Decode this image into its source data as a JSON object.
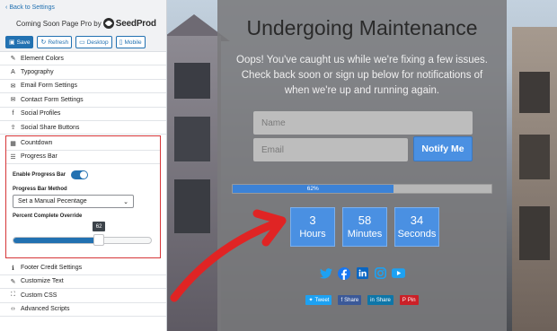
{
  "sidebar": {
    "back_link": "Back to Settings",
    "brand_text": "Coming Soon Page Pro by",
    "brand_name": "SeedProd",
    "toolbar": {
      "save": "Save",
      "refresh": "Refresh",
      "desktop": "Desktop",
      "mobile": "Mobile"
    },
    "menu_top": [
      {
        "label": "Element Colors",
        "icon": "paint-brush-icon"
      },
      {
        "label": "Typography",
        "icon": "text-icon"
      },
      {
        "label": "Email Form Settings",
        "icon": "envelope-icon"
      },
      {
        "label": "Contact Form Settings",
        "icon": "envelope-icon"
      },
      {
        "label": "Social Profiles",
        "icon": "facebook-square-icon"
      },
      {
        "label": "Social Share Buttons",
        "icon": "share-icon"
      },
      {
        "label": "Countdown",
        "icon": "calendar-icon"
      }
    ],
    "progress_panel": {
      "title": "Progress Bar",
      "enable_label": "Enable Progress Bar",
      "enabled": true,
      "method_label": "Progress Bar Method",
      "method_value": "Set a Manual Pecentage",
      "override_label": "Percent Complete Override",
      "override_value": "62",
      "override_fraction": 0.62
    },
    "menu_bottom": [
      {
        "label": "Footer Credit Settings",
        "icon": "info-icon"
      },
      {
        "label": "Customize Text",
        "icon": "pencil-icon"
      },
      {
        "label": "Custom CSS",
        "icon": "css-icon"
      },
      {
        "label": "Advanced Scripts",
        "icon": "code-icon"
      }
    ]
  },
  "preview": {
    "title": "Undergoing Maintenance",
    "description": "Oops! You've caught us while we're fixing a few issues. Check back soon or sign up below for notifications of when we're up and running again.",
    "name_placeholder": "Name",
    "email_placeholder": "Email",
    "notify_button": "Notify Me",
    "progress_label": "62%",
    "progress_fraction": 0.62,
    "countdown": [
      {
        "value": "3",
        "unit": "Hours"
      },
      {
        "value": "58",
        "unit": "Minutes"
      },
      {
        "value": "34",
        "unit": "Seconds"
      }
    ],
    "social_icons": [
      "twitter-icon",
      "facebook-icon",
      "linkedin-icon",
      "instagram-icon",
      "youtube-icon"
    ],
    "share_buttons": [
      {
        "label": "Tweet",
        "color": "#1da1f2"
      },
      {
        "label": "Share",
        "color": "#3b5998"
      },
      {
        "label": "Share",
        "color": "#0e76a8"
      },
      {
        "label": "Pin",
        "color": "#cb2027"
      }
    ]
  },
  "colors": {
    "accent": "#2271b1",
    "button_blue": "#4a90e2",
    "highlight_red": "#d63638",
    "arrow_red": "#e02424"
  }
}
